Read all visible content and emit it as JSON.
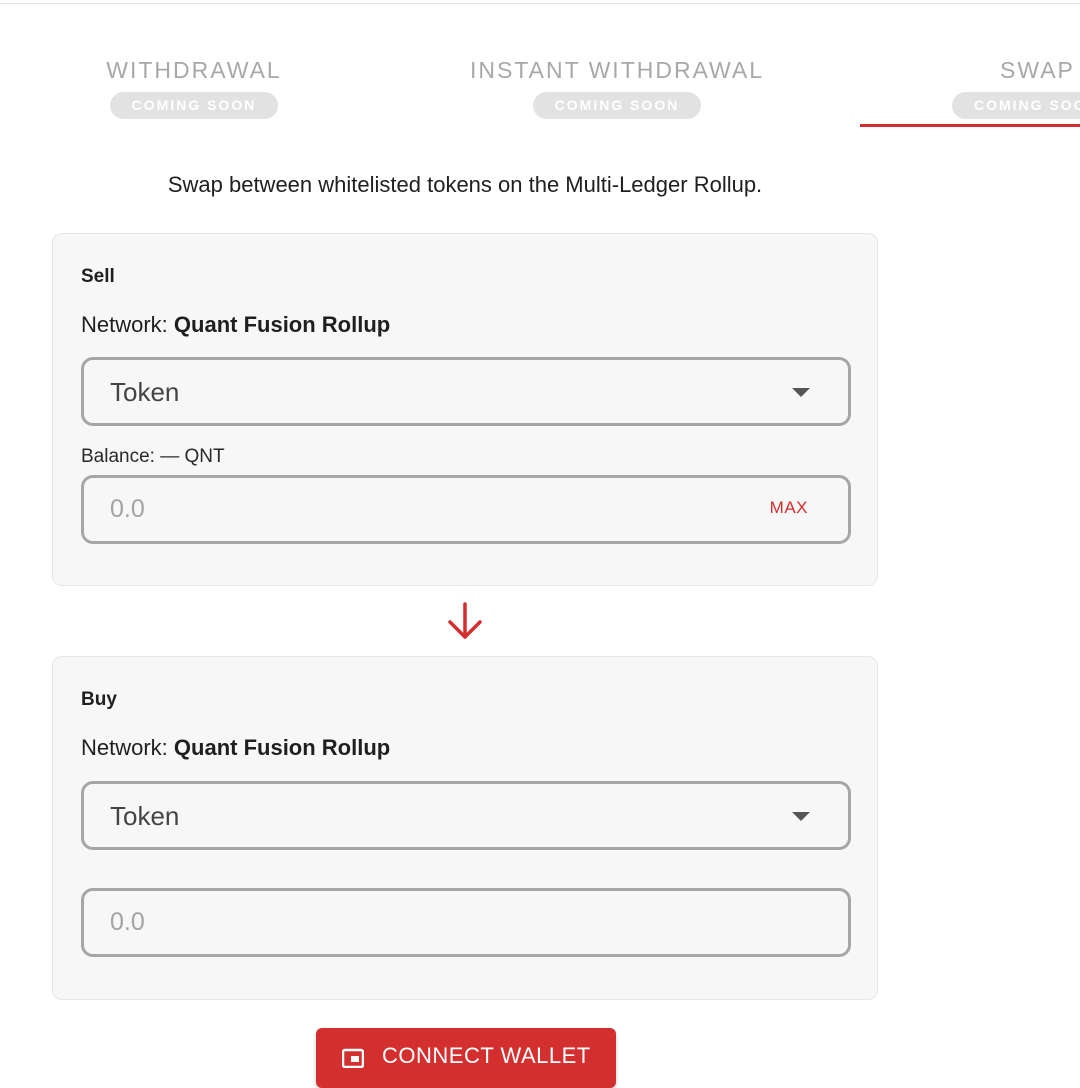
{
  "tabs": [
    {
      "label": "WITHDRAWAL",
      "badge": "COMING SOON"
    },
    {
      "label": "INSTANT WITHDRAWAL",
      "badge": "COMING SOON"
    },
    {
      "label": "SWAP",
      "badge": "COMING SOON"
    }
  ],
  "description": "Swap between whitelisted tokens on the Multi-Ledger Rollup.",
  "sell": {
    "title": "Sell",
    "network_label": "Network:",
    "network_name": "Quant Fusion Rollup",
    "token_select": "Token",
    "balance": "Balance: — QNT",
    "amount_placeholder": "0.0",
    "max_label": "MAX"
  },
  "buy": {
    "title": "Buy",
    "network_label": "Network:",
    "network_name": "Quant Fusion Rollup",
    "token_select": "Token",
    "amount_placeholder": "0.0"
  },
  "connect_wallet": "CONNECT WALLET",
  "colors": {
    "accent": "#d32f2f",
    "card_bg": "#f7f7f7",
    "field_border": "#a6a6a6"
  }
}
